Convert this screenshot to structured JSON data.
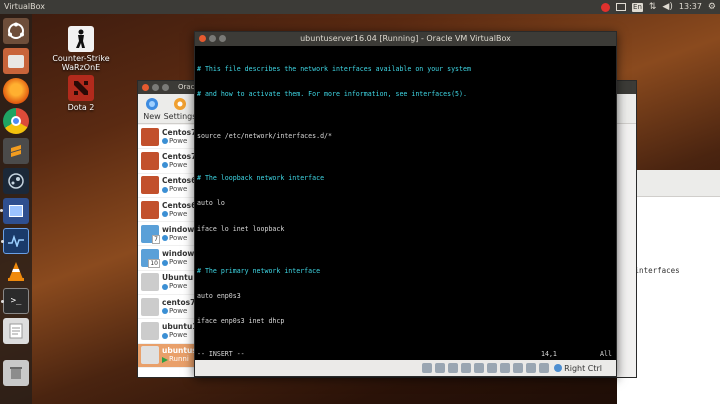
{
  "top_panel": {
    "title": "VirtualBox",
    "keyboard": "En",
    "time": "13:37"
  },
  "launcher": {
    "items": [
      "dash-icon",
      "files-icon",
      "firefox-icon",
      "chrome-icon",
      "sublime-icon",
      "steam-icon",
      "screenshot-icon",
      "system-monitor-icon",
      "vlc-icon",
      "terminal-icon",
      "text-editor-icon",
      "trash-icon"
    ]
  },
  "desktop": {
    "icons": [
      {
        "label": "Counter-Strike WaRzOnE"
      },
      {
        "label": "Dota 2"
      }
    ]
  },
  "vbox_manager": {
    "title": "Orac",
    "toolbar": {
      "new_label": "New",
      "settings_label": "Settings"
    },
    "vms": [
      {
        "name": "Centos7",
        "state": "Powe"
      },
      {
        "name": "Centos7",
        "state": "Powe"
      },
      {
        "name": "Centos6",
        "state": "Powe"
      },
      {
        "name": "Centos6",
        "state": "Powe"
      },
      {
        "name": "windows",
        "state": "Powe",
        "badge": "7"
      },
      {
        "name": "windows",
        "state": "Powe",
        "badge": "10"
      },
      {
        "name": "Ubuntu d",
        "state": "Powe"
      },
      {
        "name": "centos7-",
        "state": "Powe"
      },
      {
        "name": "ubuntu1",
        "state": "Powe"
      },
      {
        "name": "ubuntus",
        "state": "Runni"
      }
    ]
  },
  "background_panel": {
    "path_text": "rk/interfaces"
  },
  "vm_window": {
    "title": "ubuntuserver16.04 [Running] - Oracle VM VirtualBox",
    "terminal_lines": [
      {
        "text": "# This file describes the network interfaces available on your system",
        "kind": "comment"
      },
      {
        "text": "# and how to activate them. For more information, see interfaces(5).",
        "kind": "comment"
      },
      {
        "text": "",
        "kind": "normal"
      },
      {
        "text": "source /etc/network/interfaces.d/*",
        "kind": "normal"
      },
      {
        "text": "",
        "kind": "normal"
      },
      {
        "text": "# The loopback network interface",
        "kind": "comment"
      },
      {
        "text": "auto lo",
        "kind": "normal"
      },
      {
        "text": "iface lo inet loopback",
        "kind": "normal"
      },
      {
        "text": "",
        "kind": "normal"
      },
      {
        "text": "# The primary network interface",
        "kind": "comment"
      },
      {
        "text": "auto enp0s3",
        "kind": "normal"
      },
      {
        "text": "iface enp0s3 inet dhcp",
        "kind": "normal"
      }
    ],
    "status_mode": "-- INSERT --",
    "status_position": "14,1",
    "status_scroll": "All",
    "host_key_label": "Right Ctrl"
  }
}
